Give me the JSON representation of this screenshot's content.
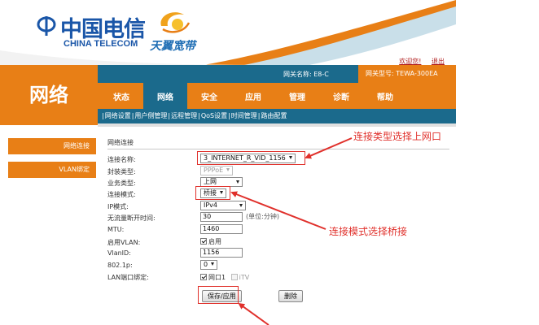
{
  "header": {
    "brand_cn": "中国电信",
    "brand_en": "CHINA TELECOM",
    "brand2_cn": "天翼宽带",
    "welcome_link": "欢迎您!",
    "logout_link": "退出"
  },
  "infobar": {
    "gateway_name": "网关名称: E8-C",
    "gateway_model": "网关型号: TEWA-300EA"
  },
  "sidebar": {
    "section_title": "网络",
    "items": [
      {
        "label": "网络连接"
      },
      {
        "label": "VLAN绑定"
      }
    ]
  },
  "tabs": [
    {
      "label": "状态"
    },
    {
      "label": "网络"
    },
    {
      "label": "安全"
    },
    {
      "label": "应用"
    },
    {
      "label": "管理"
    },
    {
      "label": "诊断"
    },
    {
      "label": "帮助"
    }
  ],
  "subnav": [
    {
      "label": "网络设置"
    },
    {
      "label": "用户侧管理"
    },
    {
      "label": "远程管理"
    },
    {
      "label": "QoS设置"
    },
    {
      "label": "时间管理"
    },
    {
      "label": "路由配置"
    }
  ],
  "form": {
    "section_label": "网络连接",
    "conn_name_label": "连接名称:",
    "conn_name_value": "3_INTERNET_R_VID_1156",
    "encap_label": "封装类型:",
    "encap_value": "PPPoE",
    "service_label": "业务类型:",
    "service_value": "上网",
    "mode_label": "连接模式:",
    "mode_value": "桥接",
    "ip_mode_label": "IP模式:",
    "ip_mode_value": "IPv4",
    "idle_label": "无流量断开时间:",
    "idle_value": "30",
    "idle_unit": "(单位:分钟)",
    "mtu_label": "MTU:",
    "mtu_value": "1460",
    "vlan_enable_label": "启用VLAN:",
    "vlan_enable_text": "启用",
    "vlan_id_label": "VlanID:",
    "vlan_id_value": "1156",
    "p8021_label": "802.1p:",
    "p8021_value": "0",
    "lan_bind_label": "LAN端口绑定:",
    "lan1_text": "网口1",
    "itv_text": "iTV",
    "save_button": "保存/应用",
    "delete_button": "删除"
  },
  "annotations": {
    "note1": "连接类型选择上网口",
    "note2": "连接模式选择桥接"
  },
  "colors": {
    "orange": "#e87f16",
    "teal": "#1b6a8c",
    "annotation_red": "#e0302b",
    "brand_blue": "#1a56a8"
  }
}
